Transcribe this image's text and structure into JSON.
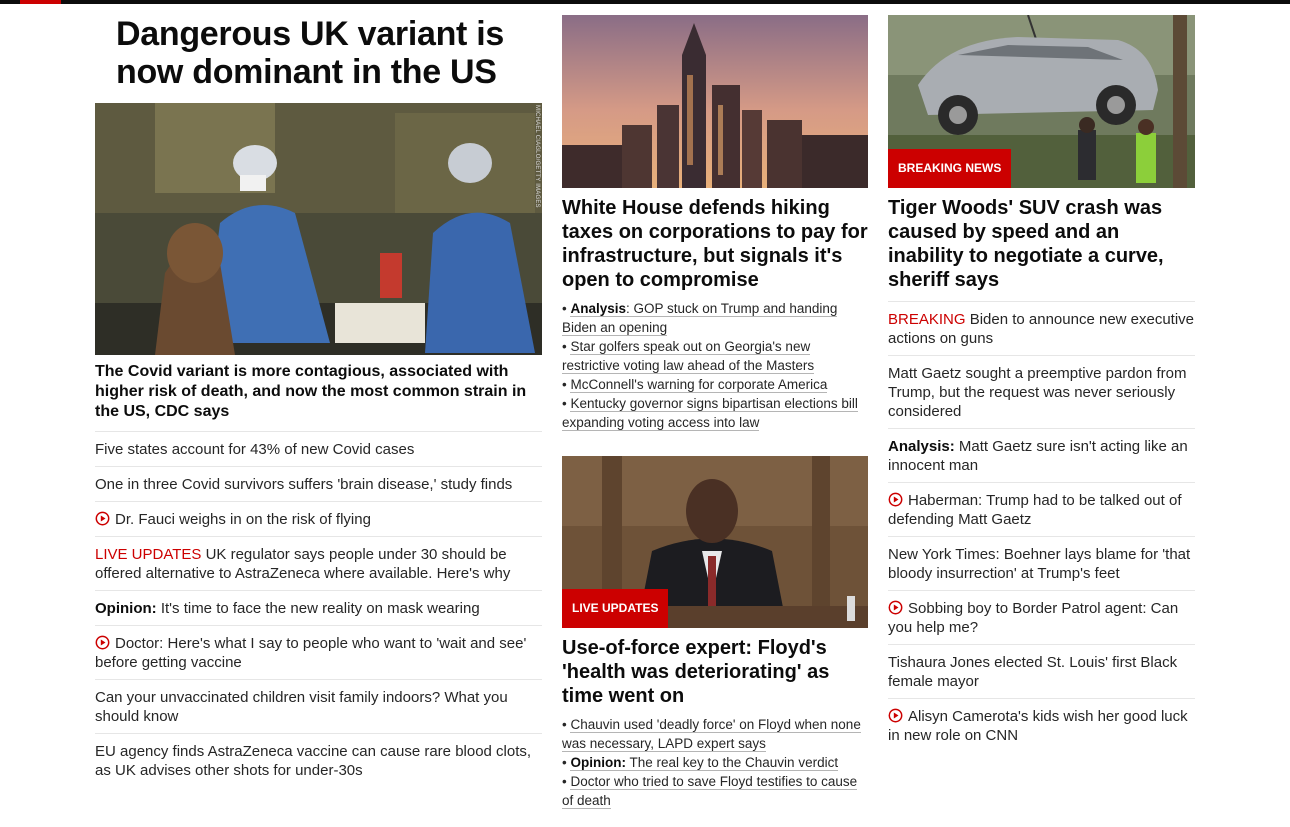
{
  "colors": {
    "accent_red": "#cc0000",
    "text": "#0c0c0c",
    "divider": "#e6e6e6"
  },
  "lead": {
    "headline": "Dangerous UK variant is now dominant in the US",
    "photo_credit": "MICHAEL CIAGLO/GETTY IMAGES",
    "subheadline": "The Covid variant is more contagious, associated with higher risk of death, and now the most common strain in the US, CDC says",
    "items": [
      {
        "text": "Five states account for 43% of new Covid cases"
      },
      {
        "text": "One in three Covid survivors suffers 'brain disease,' study finds"
      },
      {
        "text": "Dr. Fauci weighs in on the risk of flying",
        "icon": "play-icon"
      },
      {
        "prefix": "LIVE UPDATES",
        "text": " UK regulator says people under 30 should be offered alternative to AstraZeneca where available. Here's why"
      },
      {
        "bold": "Opinion:",
        "text": " It's time to face the new reality on mask wearing"
      },
      {
        "text": "Doctor: Here's what I say to people who want to 'wait and see' before getting vaccine",
        "icon": "play-icon"
      },
      {
        "text": "Can your unvaccinated children visit family indoors? What you should know"
      },
      {
        "text": "EU agency finds AstraZeneca vaccine can cause rare blood clots, as UK advises other shots for under-30s"
      }
    ]
  },
  "story1": {
    "headline": "White House defends hiking taxes on corporations to pay for infrastructure, but signals it's open to compromise",
    "bullets": [
      {
        "bold": "Analysis",
        "text": ": GOP stuck on Trump and handing Biden an opening"
      },
      {
        "text": "Star golfers speak out on Georgia's new restrictive voting law ahead of the Masters"
      },
      {
        "text": "McConnell's warning for corporate America"
      },
      {
        "text": "Kentucky governor signs bipartisan elections bill expanding voting access into law"
      }
    ]
  },
  "story2": {
    "tag": "LIVE UPDATES",
    "headline": "Use-of-force expert: Floyd's 'health was deteriorating' as time went on",
    "bullets": [
      {
        "text": "Chauvin used 'deadly force' on Floyd when none was necessary, LAPD expert says"
      },
      {
        "bold": "Opinion:",
        "text": " The real key to the Chauvin verdict"
      },
      {
        "text": "Doctor who tried to save Floyd testifies to cause of death"
      }
    ]
  },
  "story3": {
    "tag": "BREAKING NEWS",
    "headline": "Tiger Woods' SUV crash was caused by speed and an inability to negotiate a curve, sheriff says",
    "items": [
      {
        "prefix": "BREAKING",
        "text": " Biden to announce new executive actions on guns"
      },
      {
        "text": "Matt Gaetz sought a preemptive pardon from Trump, but the request was never seriously considered"
      },
      {
        "bold": "Analysis:",
        "text": " Matt Gaetz sure isn't acting like an innocent man"
      },
      {
        "text": "Haberman: Trump had to be talked out of defending Matt Gaetz",
        "icon": "play-icon"
      },
      {
        "text": "New York Times: Boehner lays blame for 'that bloody insurrection' at Trump's feet"
      },
      {
        "text": "Sobbing boy to Border Patrol agent: Can you help me?",
        "icon": "play-icon"
      },
      {
        "text": "Tishaura Jones elected St. Louis' first Black female mayor"
      },
      {
        "text": "Alisyn Camerota's kids wish her good luck in new role on CNN",
        "icon": "play-icon"
      }
    ]
  }
}
